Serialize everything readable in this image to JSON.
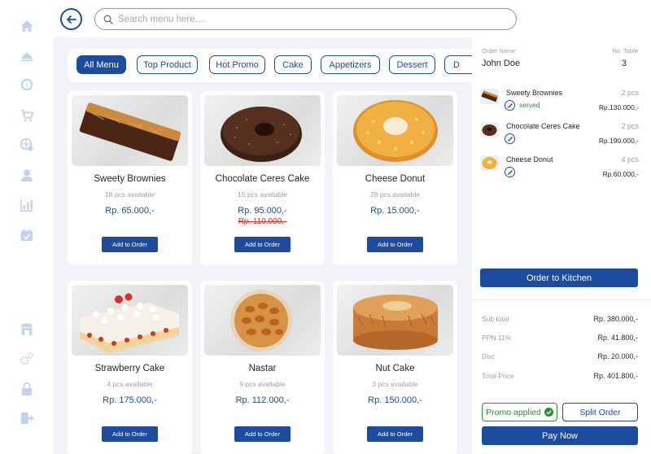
{
  "search": {
    "placeholder": "Search menu here...."
  },
  "categories": [
    "All Menu",
    "Top Product",
    "Hot Promo",
    "Cake",
    "Appetizers",
    "Dessert",
    "D"
  ],
  "products": [
    {
      "name": "Sweety Brownies",
      "availability": "18 pcs available",
      "price": "Rp. 65.000,-",
      "old_price": "",
      "button": "Add to Order"
    },
    {
      "name": "Chocolate Ceres Cake",
      "availability": "15 pcs available",
      "price": "Rp. 95.000,-",
      "old_price": "Rp. 110.000,-",
      "button": "Add to Order"
    },
    {
      "name": "Cheese Donut",
      "availability": "28 pcs available",
      "price": "Rp. 15.000,-",
      "old_price": "",
      "button": "Add to Order"
    },
    {
      "name": "Strawberry Cake",
      "availability": "4 pcs available",
      "price": "Rp. 175.000,-",
      "old_price": "",
      "button": "Add to Order"
    },
    {
      "name": "Nastar",
      "availability": "9 pcs available",
      "price": "Rp. 112.000,-",
      "old_price": "",
      "button": "Add to Order"
    },
    {
      "name": "Nut Cake",
      "availability": "3 pcs available",
      "price": "Rp. 150.000,-",
      "old_price": "",
      "button": "Add to Order"
    }
  ],
  "order": {
    "name_label": "Order Name",
    "name": "John Doe",
    "table_label": "No. Table",
    "table": "3",
    "items": [
      {
        "name": "Sweety Brownies",
        "qty": "2 pcs",
        "price": "Rp.130.000,-",
        "status": "served"
      },
      {
        "name": "Chocolate Ceres Cake",
        "qty": "2 pcs",
        "price": "Rp.190.000,-",
        "status": ""
      },
      {
        "name": "Cheese Donut",
        "qty": "4 pcs",
        "price": "Rp.60.000,-",
        "status": ""
      }
    ],
    "kitchen_button": "Order to Kitchen"
  },
  "summary": {
    "subtotal_label": "Sub total",
    "subtotal": "Rp. 380.000,-",
    "ppn_label": "PPN 11%",
    "ppn": "Rp. 41.800,-",
    "disc_label": "Disc",
    "disc": "Rp. 20.000,-",
    "total_label": "Total Price",
    "total": "Rp. 401.800,-"
  },
  "actions": {
    "promo": "Promo applied",
    "split": "Split Order",
    "pay": "Pay Now"
  },
  "colors": {
    "primary": "#1d4c9e",
    "success": "#22942b",
    "strike": "#d0302a",
    "background": "#f1f3f8",
    "icon": "#c5d3e8"
  },
  "sidebar_icons": [
    "home-icon",
    "cloche-icon",
    "coin-icon",
    "cart-icon",
    "globe-settings-icon",
    "user-icon",
    "chart-icon",
    "calendar-icon",
    "store-icon",
    "gears-icon",
    "lock-icon",
    "logout-icon"
  ]
}
